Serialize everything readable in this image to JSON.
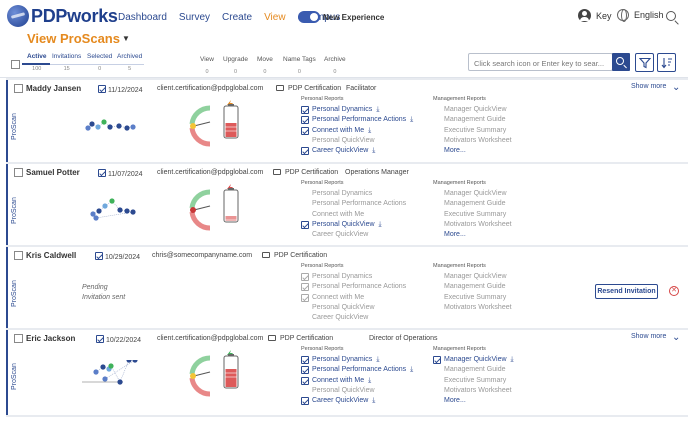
{
  "brand": {
    "name": "PDPworks"
  },
  "nav": {
    "items": [
      {
        "label": "Dashboard",
        "active": false
      },
      {
        "label": "Survey",
        "active": false
      },
      {
        "label": "Create",
        "active": false
      },
      {
        "label": "View",
        "active": true
      },
      {
        "label": "eCampus",
        "active": false
      }
    ],
    "toggle_label": "New Experience",
    "key_label": "Key",
    "language_label": "English"
  },
  "page": {
    "title": "View ProScans",
    "title_caret": "▼"
  },
  "tabs": [
    {
      "label": "Active",
      "count": "100"
    },
    {
      "label": "Invitations",
      "count": "15"
    },
    {
      "label": "Selected",
      "count": "0"
    },
    {
      "label": "Archived",
      "count": "5"
    }
  ],
  "actions": [
    {
      "label": "View",
      "count": "0"
    },
    {
      "label": "Upgrade",
      "count": "0"
    },
    {
      "label": "Move",
      "count": "0"
    },
    {
      "label": "Name Tags",
      "count": "0"
    },
    {
      "label": "Archive",
      "count": "0"
    }
  ],
  "search": {
    "placeholder": "Click search icon or Enter key to sear..."
  },
  "report_headers": {
    "personal": "Personal Reports",
    "management": "Management Reports"
  },
  "proscan_label": "ProScan",
  "show_more_label": "Show more",
  "more_label": "More...",
  "cards": [
    {
      "name": "Maddy Jansen",
      "date": "11/12/2024",
      "email": "client.certification@pdpglobal.com",
      "folder": "PDP Certification",
      "role": "Facilitator",
      "status": "complete",
      "personal": [
        {
          "label": "Personal Dynamics",
          "state": "checked"
        },
        {
          "label": "Personal Performance Actions",
          "state": "checked"
        },
        {
          "label": "Connect with Me",
          "state": "checked"
        },
        {
          "label": "Personal QuickView",
          "state": "none"
        },
        {
          "label": "Career QuickView",
          "state": "checked"
        }
      ],
      "management": [
        {
          "label": "Manager QuickView",
          "state": "none"
        },
        {
          "label": "Management Guide",
          "state": "none"
        },
        {
          "label": "Executive Summary",
          "state": "none"
        },
        {
          "label": "Motivators Worksheet",
          "state": "none"
        }
      ]
    },
    {
      "name": "Samuel Potter",
      "date": "11/07/2024",
      "email": "client.certification@pdpglobal.com",
      "folder": "PDP Certification",
      "role": "Operations Manager",
      "status": "complete",
      "personal": [
        {
          "label": "Personal Dynamics",
          "state": "none"
        },
        {
          "label": "Personal Performance Actions",
          "state": "none"
        },
        {
          "label": "Connect with Me",
          "state": "none"
        },
        {
          "label": "Personal QuickView",
          "state": "checked"
        },
        {
          "label": "Career QuickView",
          "state": "none"
        }
      ],
      "management": [
        {
          "label": "Manager QuickView",
          "state": "none"
        },
        {
          "label": "Management Guide",
          "state": "none"
        },
        {
          "label": "Executive Summary",
          "state": "none"
        },
        {
          "label": "Motivators Worksheet",
          "state": "none"
        }
      ]
    },
    {
      "name": "Kris Caldwell",
      "date": "10/29/2024",
      "email": "chris@somecompanyname.com",
      "folder": "PDP Certification",
      "role": "",
      "status": "pending",
      "pending_text": "Pending",
      "invitation_text": "Invitation sent",
      "resend_label": "Resend Invitation",
      "cancel_glyph": "✕",
      "personal": [
        {
          "label": "Personal Dynamics",
          "state": "disabled"
        },
        {
          "label": "Personal Performance Actions",
          "state": "disabled"
        },
        {
          "label": "Connect with Me",
          "state": "disabled"
        },
        {
          "label": "Personal QuickView",
          "state": "none"
        },
        {
          "label": "Career QuickView",
          "state": "none"
        }
      ],
      "management": [
        {
          "label": "Manager QuickView",
          "state": "none"
        },
        {
          "label": "Management Guide",
          "state": "none"
        },
        {
          "label": "Executive Summary",
          "state": "none"
        },
        {
          "label": "Motivators Worksheet",
          "state": "none"
        }
      ]
    },
    {
      "name": "Eric Jackson",
      "date": "10/22/2024",
      "email": "client.certification@pdpglobal.com",
      "folder": "PDP Certification",
      "role": "Director of Operations",
      "status": "complete",
      "personal": [
        {
          "label": "Personal Dynamics",
          "state": "checked"
        },
        {
          "label": "Personal Performance Actions",
          "state": "checked"
        },
        {
          "label": "Connect with Me",
          "state": "checked"
        },
        {
          "label": "Personal QuickView",
          "state": "none"
        },
        {
          "label": "Career QuickView",
          "state": "checked"
        }
      ],
      "management": [
        {
          "label": "Manager QuickView",
          "state": "checked"
        },
        {
          "label": "Management Guide",
          "state": "none"
        },
        {
          "label": "Executive Summary",
          "state": "none"
        },
        {
          "label": "Motivators Worksheet",
          "state": "none"
        }
      ]
    }
  ],
  "colors": {
    "brand_blue": "#2c4a90",
    "accent_orange": "#e58a1f",
    "gauge_green": "#8fd19e",
    "gauge_red": "#e88888",
    "battery_red": "#d94848",
    "energy_green": "#3fb25a"
  }
}
